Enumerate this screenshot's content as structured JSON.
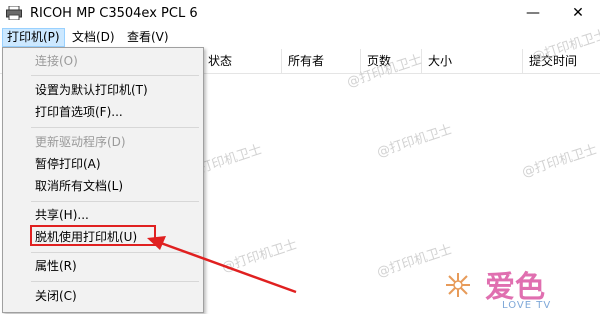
{
  "window": {
    "title": "RICOH MP C3504ex PCL 6",
    "minimize_glyph": "—",
    "close_glyph": "✕"
  },
  "menubar": {
    "items": [
      {
        "label": "打印机(P)"
      },
      {
        "label": "文档(D)"
      },
      {
        "label": "查看(V)"
      }
    ]
  },
  "columns": [
    {
      "label": "状态"
    },
    {
      "label": "所有者"
    },
    {
      "label": "页数"
    },
    {
      "label": "大小"
    },
    {
      "label": "提交时间"
    }
  ],
  "printer_menu": {
    "items": [
      {
        "label": "连接(O)",
        "enabled": false
      },
      {
        "label": "设置为默认打印机(T)",
        "enabled": true
      },
      {
        "label": "打印首选项(F)...",
        "enabled": true
      },
      {
        "label": "更新驱动程序(D)",
        "enabled": false
      },
      {
        "label": "暂停打印(A)",
        "enabled": true
      },
      {
        "label": "取消所有文档(L)",
        "enabled": true
      },
      {
        "label": "共享(H)...",
        "enabled": true
      },
      {
        "label": "脱机使用打印机(U)",
        "enabled": true,
        "highlighted": true
      },
      {
        "label": "属性(R)",
        "enabled": true
      },
      {
        "label": "关闭(C)",
        "enabled": true
      }
    ]
  },
  "watermark": {
    "text": "@打印机卫士"
  },
  "logo": {
    "text": "爱色",
    "sub": "LOVE TV"
  },
  "colors": {
    "highlight": "#e02020",
    "menu_active": "#cce8ff"
  }
}
